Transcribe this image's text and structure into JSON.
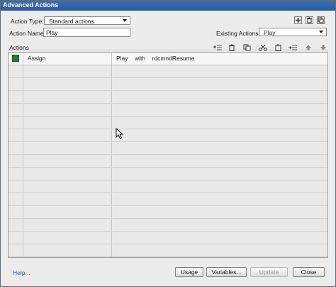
{
  "window": {
    "title": "Advanced Actions"
  },
  "form": {
    "action_type_label": "Action Type:",
    "action_type_value": "Standard actions",
    "action_name_label": "Action Name:",
    "action_name_value": "Play",
    "existing_actions_label": "Existing Actions:",
    "existing_actions_value": "Play"
  },
  "top_icons": [
    "add-icon",
    "delete-icon",
    "duplicate-icon"
  ],
  "actions_panel": {
    "label": "Actions",
    "toolbar_icons": [
      "add-row-icon",
      "delete-row-icon",
      "copy-icon",
      "cut-icon",
      "paste-icon",
      "insert-row-icon",
      "move-up-icon",
      "move-down-icon"
    ],
    "rows": [
      {
        "status": "green",
        "action": "Assign",
        "value": "Play    with    rdcmndResume"
      }
    ],
    "empty_rows": 15
  },
  "footer": {
    "help_link": "Help...",
    "usage_button": "Usage",
    "variables_button": "Variables...",
    "update_button": "Update",
    "close_button": "Close"
  }
}
